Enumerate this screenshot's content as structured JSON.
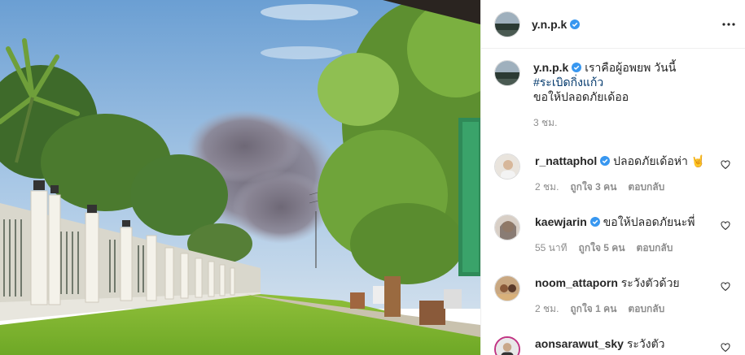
{
  "post": {
    "username": "y.n.p.k",
    "caption_line1": "เราคือผู้อพยพ วันนี้",
    "hashtag": "#ระเบิดกิ่งแก้ว",
    "caption_line3": "ขอให้ปลอดภัยเด้ออ",
    "time": "3 ชม."
  },
  "comments": [
    {
      "username": "r_nattaphol",
      "verified": true,
      "text": "ปลอดภัยเด้อห่า",
      "emoji": "🤘",
      "time": "2 ชม.",
      "likes": "ถูกใจ 3 คน",
      "reply": "ตอบกลับ"
    },
    {
      "username": "kaewjarin",
      "verified": true,
      "text": "ขอให้ปลอดภัยนะพี่",
      "time": "55 นาที",
      "likes": "ถูกใจ 5 คน",
      "reply": "ตอบกลับ"
    },
    {
      "username": "noom_attaporn",
      "verified": false,
      "text": "ระวังตัวด้วย",
      "time": "2 ชม.",
      "likes": "ถูกใจ 1 คน",
      "reply": "ตอบกลับ"
    },
    {
      "username": "aonsarawut_sky",
      "verified": false,
      "text": "ระวังตัว"
    }
  ],
  "icons": {
    "more": "more-options-icon",
    "verified": "verified-badge-icon",
    "heart": "heart-icon"
  },
  "colors": {
    "verified": "#3897f0",
    "hashtag": "#00376b",
    "muted": "#8e8e8e"
  }
}
